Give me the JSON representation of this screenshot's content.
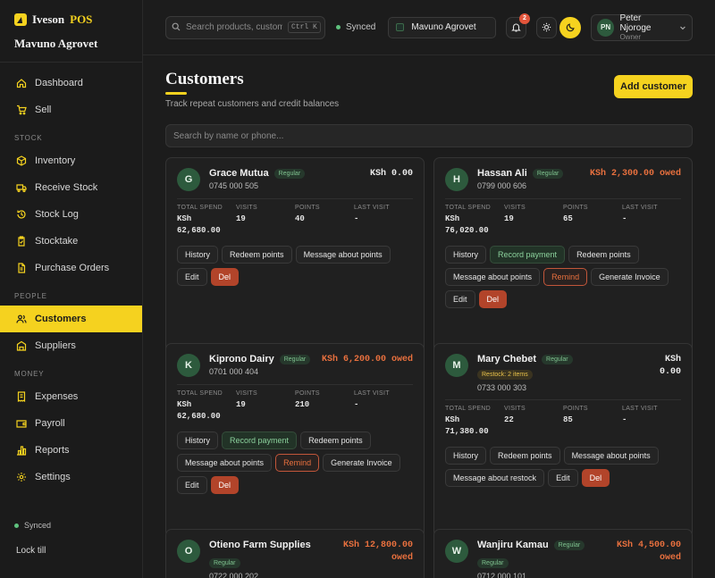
{
  "sidebar": {
    "brand": "Iveson",
    "brand_accent": "POS",
    "store_name": "Mavuno Agrovet",
    "items_top": [
      {
        "label": "Dashboard",
        "icon": "home-icon"
      },
      {
        "label": "Sell",
        "icon": "cart-icon"
      }
    ],
    "section_stock": "STOCK",
    "items_stock": [
      {
        "label": "Inventory",
        "icon": "box-icon"
      },
      {
        "label": "Receive Stock",
        "icon": "truck-icon"
      },
      {
        "label": "Stock Log",
        "icon": "history-icon"
      },
      {
        "label": "Stocktake",
        "icon": "clipboard-icon"
      },
      {
        "label": "Purchase Orders",
        "icon": "document-icon"
      }
    ],
    "section_people": "PEOPLE",
    "items_people": [
      {
        "label": "Customers",
        "icon": "users-icon",
        "active": true
      },
      {
        "label": "Suppliers",
        "icon": "building-icon"
      }
    ],
    "section_money": "MONEY",
    "items_money": [
      {
        "label": "Expenses",
        "icon": "receipt-icon"
      },
      {
        "label": "Payroll",
        "icon": "wallet-icon"
      },
      {
        "label": "Reports",
        "icon": "bar-chart-icon"
      },
      {
        "label": "Settings",
        "icon": "gear-icon"
      }
    ],
    "sync_status": "Synced",
    "lock_label": "Lock till"
  },
  "topbar": {
    "search_placeholder": "Search products, customers",
    "shortcut": "Ctrl K",
    "sync_status": "Synced",
    "store": "Mavuno Agrovet",
    "notification_count": "2",
    "user_initials": "PN",
    "user_name": "Peter Njoroge",
    "user_role": "Owner"
  },
  "page": {
    "title": "Customers",
    "subtitle": "Track repeat customers and credit balances",
    "add_button": "Add customer",
    "search_placeholder": "Search by name or phone..."
  },
  "stat_labels": {
    "spend": "TOTAL SPEND",
    "visits": "VISITS",
    "points": "POINTS",
    "last": "LAST VISIT"
  },
  "customers": [
    {
      "initial": "G",
      "name": "Grace Mutua",
      "tag": "Regular",
      "phone": "0745 000 505",
      "balance": "KSh 0.00",
      "owed": false,
      "spend": "KSh\n62,680.00",
      "visits": "19",
      "points": "40",
      "last_visit": "-",
      "actions": [
        "History",
        "Redeem points",
        "Message about points",
        "Edit",
        "Del"
      ]
    },
    {
      "initial": "H",
      "name": "Hassan Ali",
      "tag": "Regular",
      "phone": "0799 000 606",
      "balance": "KSh 2,300.00 owed",
      "owed": true,
      "spend": "KSh\n76,020.00",
      "visits": "19",
      "points": "65",
      "last_visit": "-",
      "actions": [
        "History",
        "Record payment",
        "Redeem points",
        "Message about points",
        "Remind",
        "Generate Invoice",
        "Edit",
        "Del"
      ]
    },
    {
      "initial": "K",
      "name": "Kiprono Dairy",
      "tag": "Regular",
      "phone": "0701 000 404",
      "balance": "KSh 6,200.00 owed",
      "owed": true,
      "spend": "KSh\n62,680.00",
      "visits": "19",
      "points": "210",
      "last_visit": "-",
      "actions": [
        "History",
        "Record payment",
        "Redeem points",
        "Message about points",
        "Remind",
        "Generate Invoice",
        "Edit",
        "Del"
      ]
    },
    {
      "initial": "M",
      "name": "Mary Chebet",
      "tag": "Regular",
      "warn": "Restock: 2 items",
      "phone": "0733 000 303",
      "balance": "KSh\n0.00",
      "owed": false,
      "spend": "KSh\n71,380.00",
      "visits": "22",
      "points": "85",
      "last_visit": "-",
      "actions": [
        "History",
        "Redeem points",
        "Message about points",
        "Message about restock",
        "Edit",
        "Del"
      ]
    },
    {
      "initial": "O",
      "name": "Otieno Farm Supplies",
      "tag": "Regular",
      "phone": "0722 000 202",
      "balance": "KSh 12,800.00\nowed",
      "owed": true
    },
    {
      "initial": "W",
      "name": "Wanjiru Kamau",
      "tag": "Regular",
      "phone": "0712 000 101",
      "balance": "KSh 4,500.00\nowed",
      "owed": true
    }
  ],
  "colors": {
    "accent": "#f5d21f",
    "owed": "#e8703e",
    "background": "#1c1c1c",
    "success": "#5fc27e"
  }
}
